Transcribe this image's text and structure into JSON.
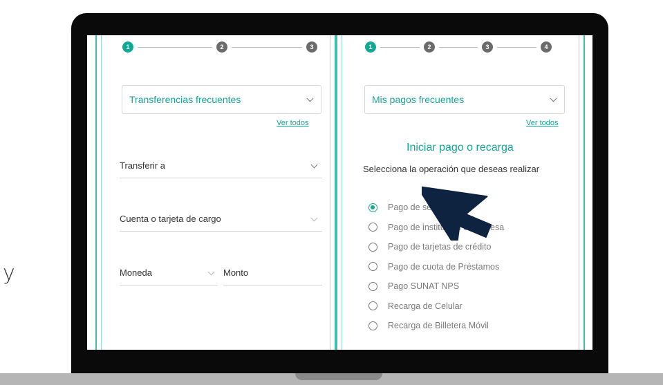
{
  "side_letter": "y",
  "left_panel": {
    "steps": [
      "1",
      "2",
      "3"
    ],
    "frequent_dropdown": "Transferencias frecuentes",
    "see_all": "Ver todos",
    "transfer_to": "Transferir a",
    "charge_account": "Cuenta o tarjeta de cargo",
    "currency": "Moneda",
    "amount": "Monto"
  },
  "right_panel": {
    "steps": [
      "1",
      "2",
      "3",
      "4"
    ],
    "frequent_dropdown": "Mis pagos frecuentes",
    "see_all": "Ver todos",
    "title": "Iniciar pago o recarga",
    "prompt": "Selecciona la operación que deseas realizar",
    "options": [
      "Pago de servicios",
      "Pago de institución o empresa",
      "Pago de tarjetas de crédito",
      "Pago de cuota de Préstamos",
      "Pago SUNAT NPS",
      "Recarga de Celular",
      "Recarga de Billetera Móvil"
    ],
    "selected_option_index": 0
  },
  "colors": {
    "accent": "#11a896",
    "cursor": "#0d2340",
    "laptop_frame": "#0a0a0a"
  }
}
